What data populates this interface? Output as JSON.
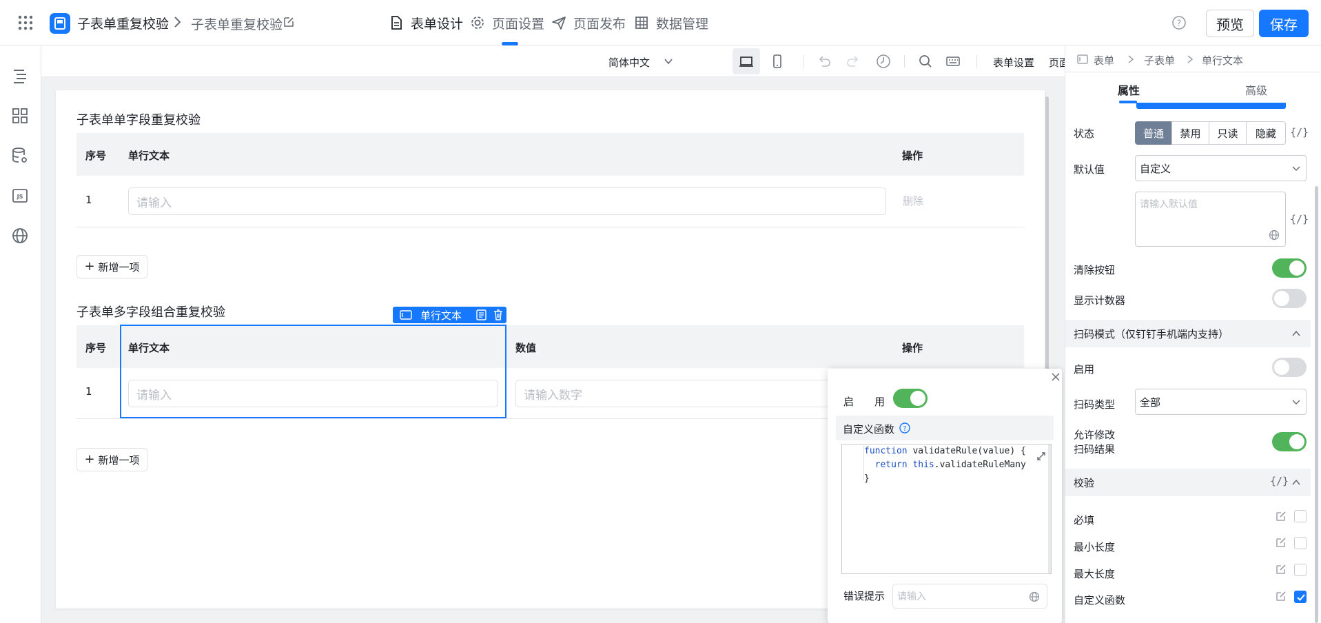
{
  "header": {
    "app_name": "子表单重复校验",
    "page_name": "子表单重复校验",
    "tabs": [
      {
        "label": "表单设计",
        "icon": "document-icon",
        "active": true
      },
      {
        "label": "页面设置",
        "icon": "gear-icon",
        "active": false
      },
      {
        "label": "页面发布",
        "icon": "send-icon",
        "active": false
      },
      {
        "label": "数据管理",
        "icon": "table-grid-icon",
        "active": false
      }
    ],
    "preview_label": "预览",
    "save_label": "保存",
    "accent": "#1677ff"
  },
  "left_rail": [
    "outline-icon",
    "components-icon",
    "datasource-icon",
    "js-icon",
    "globe-icon"
  ],
  "toolbar": {
    "language": "简体中文",
    "form_settings": "表单设置",
    "page_props": "页面属性"
  },
  "form": {
    "section1": {
      "title": "子表单单字段重复校验",
      "columns": [
        "序号",
        "单行文本",
        "操作"
      ],
      "rows": [
        {
          "index": "1",
          "placeholder": "请输入",
          "action": "删除"
        }
      ],
      "add_label": "新增一项"
    },
    "section2": {
      "title": "子表单多字段组合重复校验",
      "columns": [
        "序号",
        "单行文本",
        "数值",
        "操作"
      ],
      "rows": [
        {
          "index": "1",
          "placeholder": "请输入",
          "number_placeholder": "请输入数字"
        }
      ],
      "add_label": "新增一项",
      "selected_tag": "单行文本"
    }
  },
  "popup": {
    "enable_label": "启　　用",
    "enabled": true,
    "custom_func_label": "自定义函数",
    "code": [
      "function validateRule(value) {",
      "  return this.validateRuleMany",
      "}"
    ],
    "error_label": "错误提示",
    "error_placeholder": "请输入"
  },
  "right_panel": {
    "breadcrumb": [
      "表单",
      "子表单",
      "单行文本"
    ],
    "tabs": [
      "属性",
      "高级"
    ],
    "status_label": "状态",
    "status_options": [
      "普通",
      "禁用",
      "只读",
      "隐藏"
    ],
    "status_selected": "普通",
    "fx_label": "{/}",
    "default_label": "默认值",
    "default_select": "自定义",
    "default_placeholder": "请输入默认值",
    "clear_btn_label": "清除按钮",
    "clear_btn_on": true,
    "counter_label": "显示计数器",
    "counter_on": false,
    "scan_section": "扫码模式（仅钉钉手机端内支持）",
    "scan_enable_label": "启用",
    "scan_enable_on": false,
    "scan_type_label": "扫码类型",
    "scan_type_value": "全部",
    "allow_edit_label_1": "允许修改",
    "allow_edit_label_2": "扫码结果",
    "allow_edit_on": true,
    "validation_section": "校验",
    "rules": [
      {
        "label": "必填",
        "checked": false
      },
      {
        "label": "最小长度",
        "checked": false
      },
      {
        "label": "最大长度",
        "checked": false
      },
      {
        "label": "自定义函数",
        "checked": true
      }
    ]
  }
}
